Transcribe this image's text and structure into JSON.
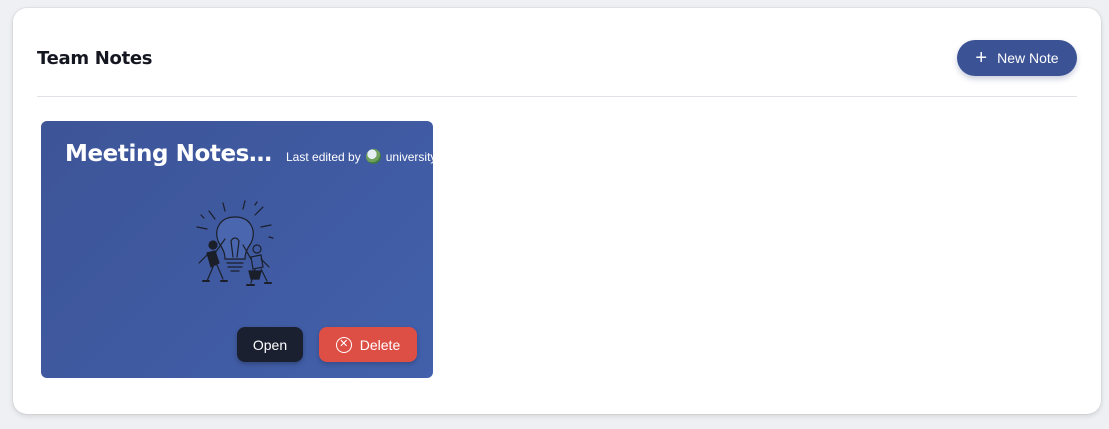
{
  "header": {
    "title": "Team Notes",
    "new_note_label": "New Note",
    "new_note_icon": "plus-icon"
  },
  "notes": [
    {
      "title": "Meeting Notes J...",
      "edited_prefix": "Last edited by",
      "editor": "university",
      "open_label": "Open",
      "delete_label": "Delete",
      "delete_icon": "x-circle-icon"
    }
  ],
  "colors": {
    "primary": "#3b5394",
    "card_bg": "#4260ab",
    "open_bg": "#1a2030",
    "delete_bg": "#dd4f45"
  }
}
